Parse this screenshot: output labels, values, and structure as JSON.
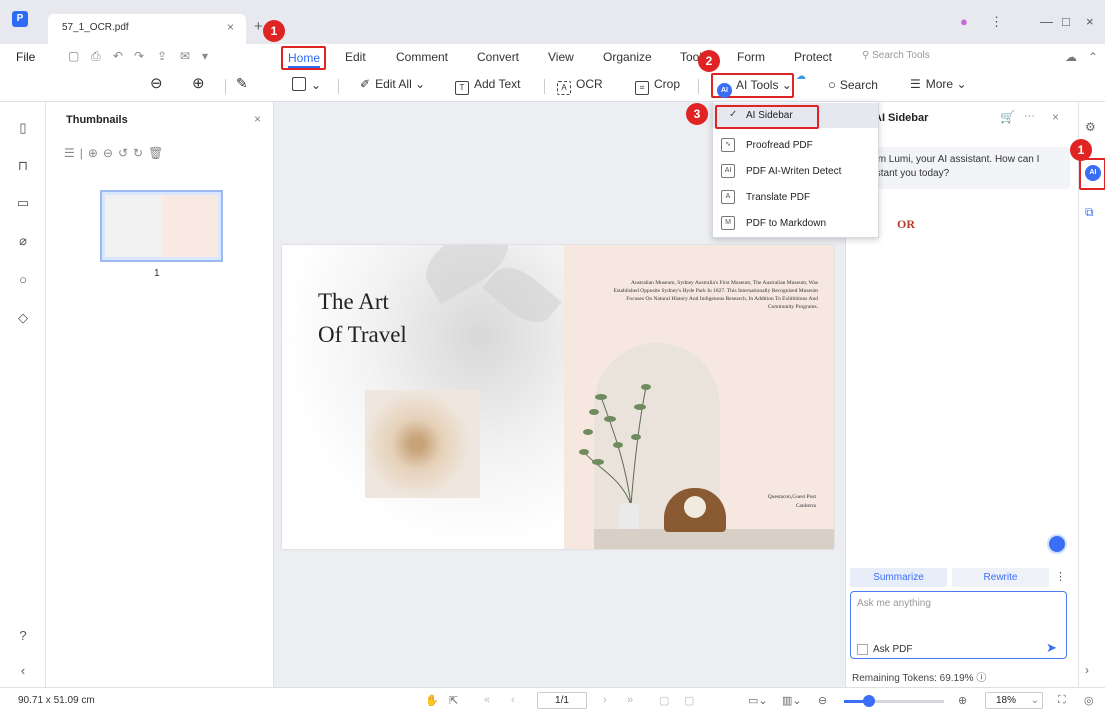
{
  "window": {
    "tab_title": "57_1_OCR.pdf",
    "tab_close": "×",
    "new_tab": "+",
    "minimize": "—",
    "maximize": "□",
    "close": "×"
  },
  "menubar": {
    "file": "File",
    "items": [
      "Home",
      "Edit",
      "Comment",
      "Convert",
      "View",
      "Organize",
      "Tools",
      "Form",
      "Protect"
    ],
    "search_tools_placeholder": "Search Tools"
  },
  "toolbar": {
    "edit_all": "Edit All",
    "add_text": "Add Text",
    "ocr": "OCR",
    "crop": "Crop",
    "ai_tools": "AI Tools",
    "search": "Search",
    "more": "More"
  },
  "ai_tools_menu": {
    "items": [
      "AI Sidebar",
      "Proofread PDF",
      "PDF AI-Writen Detect",
      "Translate PDF",
      "PDF to Markdown"
    ],
    "checked_item": "AI Sidebar"
  },
  "thumbnails": {
    "title": "Thumbnails",
    "page_number": "1"
  },
  "document": {
    "title_line1": "The Art",
    "title_line2": "Of Travel",
    "paragraph": "Australian Museum, Sydney Australia's First Museum, The Australian Museum, Was Established Opposite Sydney's Hyde Park In 1827. This Internationally Recognised Museum Focuses On Natural History And Indigenous Research, In Addition To Exhibitions And Community Programs.",
    "guest_line1": "Questacon,Guest Post",
    "guest_line2": "Canberra"
  },
  "ai_sidebar": {
    "title": "AI Sidebar",
    "greeting": "Hi, I'm Lumi, your AI assistant. How can I assistant you today?",
    "or_label": "OR",
    "tab_summarize": "Summarize",
    "tab_rewrite": "Rewrite",
    "input_placeholder": "Ask me anything",
    "ask_pdf_label": "Ask PDF",
    "tokens": "Remaining Tokens: 69.19%"
  },
  "statusbar": {
    "dimensions": "90.71 x 51.09 cm",
    "page": "1/1",
    "zoom": "18%",
    "zoom_level": 0.25
  },
  "callouts": [
    "1",
    "2",
    "3",
    "1"
  ],
  "colors": {
    "accent": "#2f6cf5",
    "highlight_box": "#e02424",
    "or_text": "#b53b2c"
  }
}
